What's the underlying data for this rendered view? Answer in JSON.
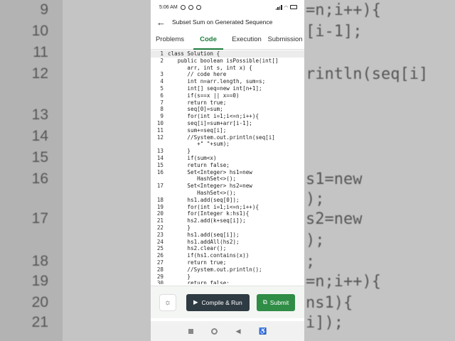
{
  "background": {
    "lines": [
      {
        "num": "9",
        "code": "=n;i++){"
      },
      {
        "num": "10",
        "code": "[i-1];"
      },
      {
        "num": "11",
        "code": ""
      },
      {
        "num": "12",
        "code": "rintln(seq[i]"
      },
      {
        "num": "13",
        "code": ""
      },
      {
        "num": "14",
        "code": ""
      },
      {
        "num": "15",
        "code": ""
      },
      {
        "num": "16",
        "code": "s1=new"
      },
      {
        "num": "",
        "code": ");"
      },
      {
        "num": "17",
        "code": "s2=new"
      },
      {
        "num": "",
        "code": ");"
      },
      {
        "num": "18",
        "code": ";"
      },
      {
        "num": "19",
        "code": "=n;i++){"
      },
      {
        "num": "20",
        "code": "ns1){"
      },
      {
        "num": "21",
        "code": "i]);"
      }
    ]
  },
  "status_bar": {
    "time": "5:06 AM"
  },
  "app_bar": {
    "title": "Subset Sum on Generated Sequence"
  },
  "tabs": [
    {
      "label": "Problems",
      "active": false
    },
    {
      "label": "Code",
      "active": true
    },
    {
      "label": "Execution",
      "active": false
    },
    {
      "label": "Submission",
      "active": false
    }
  ],
  "code_lines": [
    {
      "n": "1",
      "t": "class Solution {"
    },
    {
      "n": "2",
      "t": "   public boolean isPossible(int[]"
    },
    {
      "n": "",
      "t": "      arr, int s, int x) {"
    },
    {
      "n": "3",
      "t": "      // code here"
    },
    {
      "n": "4",
      "t": "      int n=arr.length, sum=s;"
    },
    {
      "n": "5",
      "t": "      int[] seq=new int[n+1];"
    },
    {
      "n": "6",
      "t": "      if(s==x || x==0)"
    },
    {
      "n": "7",
      "t": "      return true;"
    },
    {
      "n": "8",
      "t": "      seq[0]=sum;"
    },
    {
      "n": "9",
      "t": "      for(int i=1;i<=n;i++){"
    },
    {
      "n": "10",
      "t": "      seq[i]=sum+arr[i-1];"
    },
    {
      "n": "11",
      "t": "      sum+=seq[i];"
    },
    {
      "n": "12",
      "t": "      //System.out.println(seq[i]"
    },
    {
      "n": "",
      "t": "         +\" \"+sum);"
    },
    {
      "n": "13",
      "t": "      }"
    },
    {
      "n": "14",
      "t": "      if(sum<x)"
    },
    {
      "n": "15",
      "t": "      return false;"
    },
    {
      "n": "16",
      "t": "      Set<Integer> hs1=new"
    },
    {
      "n": "",
      "t": "         HashSet<>();"
    },
    {
      "n": "17",
      "t": "      Set<Integer> hs2=new"
    },
    {
      "n": "",
      "t": "         HashSet<>();"
    },
    {
      "n": "18",
      "t": "      hs1.add(seq[0]);"
    },
    {
      "n": "19",
      "t": "      for(int i=1;i<=n;i++){"
    },
    {
      "n": "20",
      "t": "      for(Integer k:hs1){"
    },
    {
      "n": "21",
      "t": "      hs2.add(k+seq[i]);"
    },
    {
      "n": "22",
      "t": "      }"
    },
    {
      "n": "23",
      "t": "      hs1.add(seq[i]);"
    },
    {
      "n": "24",
      "t": "      hs1.addAll(hs2);"
    },
    {
      "n": "25",
      "t": "      hs2.clear();"
    },
    {
      "n": "26",
      "t": "      if(hs1.contains(x))"
    },
    {
      "n": "27",
      "t": "      return true;"
    },
    {
      "n": "28",
      "t": "      //System.out.println();"
    },
    {
      "n": "29",
      "t": "      }"
    },
    {
      "n": "30",
      "t": "      return false;"
    }
  ],
  "actions": {
    "compile_run": "Compile & Run",
    "submit": "Submit"
  },
  "colors": {
    "accent": "#1b7b3a",
    "submit_bg": "#2f8d46",
    "run_bg": "#2f3b42"
  }
}
